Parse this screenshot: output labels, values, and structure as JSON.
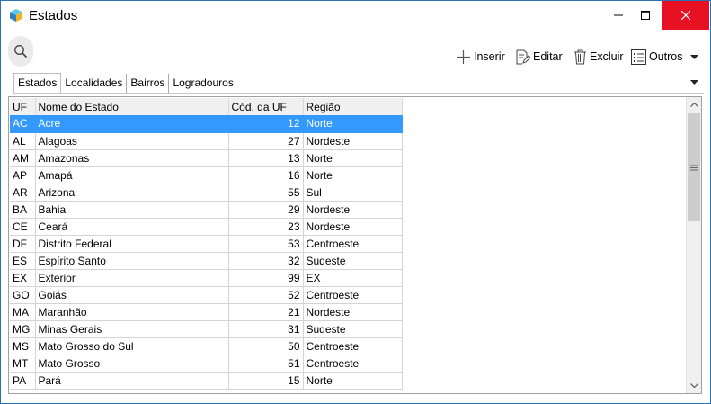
{
  "window": {
    "title": "Estados"
  },
  "toolbar": {
    "search_icon": "search-icon",
    "inserir": "Inserir",
    "editar": "Editar",
    "excluir": "Excluir",
    "outros": "Outros"
  },
  "tabs": [
    "Estados",
    "Localidades",
    "Bairros",
    "Logradouros"
  ],
  "grid": {
    "columns": {
      "uf": "UF",
      "nome": "Nome do Estado",
      "cod": "Cód. da UF",
      "regiao": "Região"
    },
    "rows": [
      [
        "AC",
        "Acre",
        "12",
        "Norte"
      ],
      [
        "AL",
        "Alagoas",
        "27",
        "Nordeste"
      ],
      [
        "AM",
        "Amazonas",
        "13",
        "Norte"
      ],
      [
        "AP",
        "Amapá",
        "16",
        "Norte"
      ],
      [
        "AR",
        "Arizona",
        "55",
        "Sul"
      ],
      [
        "BA",
        "Bahia",
        "29",
        "Nordeste"
      ],
      [
        "CE",
        "Ceará",
        "23",
        "Nordeste"
      ],
      [
        "DF",
        "Distrito Federal",
        "53",
        "Centroeste"
      ],
      [
        "ES",
        "Espírito Santo",
        "32",
        "Sudeste"
      ],
      [
        "EX",
        "Exterior",
        "99",
        "EX"
      ],
      [
        "GO",
        "Goiás",
        "52",
        "Centroeste"
      ],
      [
        "MA",
        "Maranhão",
        "21",
        "Nordeste"
      ],
      [
        "MG",
        "Minas Gerais",
        "31",
        "Sudeste"
      ],
      [
        "MS",
        "Mato Grosso do Sul",
        "50",
        "Centroeste"
      ],
      [
        "MT",
        "Mato Grosso",
        "51",
        "Centroeste"
      ],
      [
        "PA",
        "Pará",
        "15",
        "Norte"
      ]
    ],
    "selected_row": 0
  },
  "colors": {
    "accent": "#3399ff",
    "close": "#e81123"
  }
}
